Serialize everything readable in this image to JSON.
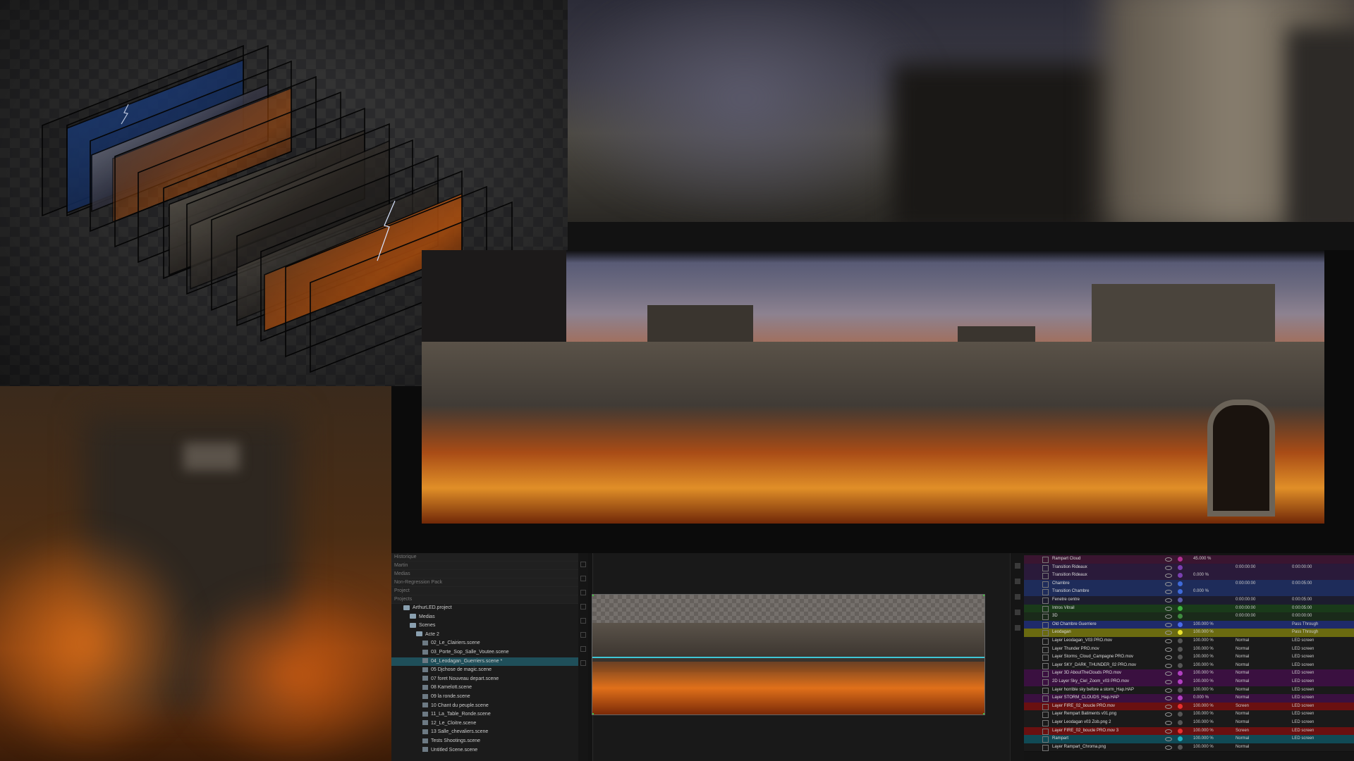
{
  "project_tree": {
    "headers": [
      "Historique",
      "Martin",
      "Medias",
      "Non-Regression Pack",
      "Project",
      "Projects"
    ],
    "items": [
      {
        "label": "ArthurLED.project",
        "kind": "project",
        "indent": 1,
        "selected": false
      },
      {
        "label": "Medias",
        "kind": "folder",
        "indent": 2,
        "selected": false
      },
      {
        "label": "Scenes",
        "kind": "folder",
        "indent": 2,
        "selected": false
      },
      {
        "label": "Acte 2",
        "kind": "folder",
        "indent": 3,
        "selected": false
      },
      {
        "label": "02_Le_Clairiers.scene",
        "kind": "scene",
        "indent": 4,
        "selected": false
      },
      {
        "label": "03_Porte_Sop_Salle_Voutee.scene",
        "kind": "scene",
        "indent": 4,
        "selected": false
      },
      {
        "label": "04_Leodagan_Guerriers.scene *",
        "kind": "scene",
        "indent": 4,
        "selected": true
      },
      {
        "label": "05 Djchose de magic.scene",
        "kind": "scene",
        "indent": 4,
        "selected": false
      },
      {
        "label": "07 foret Nouveau depart.scene",
        "kind": "scene",
        "indent": 4,
        "selected": false
      },
      {
        "label": "08 Kamelott.scene",
        "kind": "scene",
        "indent": 4,
        "selected": false
      },
      {
        "label": "09 la ronde.scene",
        "kind": "scene",
        "indent": 4,
        "selected": false
      },
      {
        "label": "10 Chant du peuple.scene",
        "kind": "scene",
        "indent": 4,
        "selected": false
      },
      {
        "label": "11_La_Table_Ronde.scene",
        "kind": "scene",
        "indent": 4,
        "selected": false
      },
      {
        "label": "12_Le_Cloitre.scene",
        "kind": "scene",
        "indent": 4,
        "selected": false
      },
      {
        "label": "13 Salle_chevaliers.scene",
        "kind": "scene",
        "indent": 4,
        "selected": false
      },
      {
        "label": "Tests Shootings.scene",
        "kind": "scene",
        "indent": 4,
        "selected": false
      },
      {
        "label": "Untitled Scene.scene",
        "kind": "scene",
        "indent": 4,
        "selected": false
      }
    ]
  },
  "layers": {
    "rows": [
      {
        "name": "Rampart Cloud",
        "opacity": "45.000 %",
        "blend": "",
        "target": "",
        "bg": "#3a1530",
        "dot": "#b03090"
      },
      {
        "name": "Transition Rideaux",
        "opacity": "",
        "blend": "0:00:00:00",
        "target": "0:00:00:00",
        "bg": "#2a1a3a",
        "dot": "#7a3fb0"
      },
      {
        "name": "Transition Rideaux",
        "opacity": "0.000 %",
        "blend": "",
        "target": "",
        "bg": "#2a1a3a",
        "dot": "#7a3fb0"
      },
      {
        "name": "Chambre",
        "opacity": "",
        "blend": "0:00:00:00",
        "target": "0:00:05:00",
        "bg": "#1e2c5a",
        "dot": "#3f6ad8"
      },
      {
        "name": "Transition Chambre",
        "opacity": "0.000 %",
        "blend": "",
        "target": "",
        "bg": "#1e2c5a",
        "dot": "#3f6ad8"
      },
      {
        "name": "Fenetre centre",
        "opacity": "",
        "blend": "0:00:00:00",
        "target": "0:00:05:00",
        "bg": "#1c1c2e",
        "dot": "#5a5aa8"
      },
      {
        "name": "Intros Vitrail",
        "opacity": "",
        "blend": "0:00:00:00",
        "target": "0:00:05:00",
        "bg": "#1a3a1a",
        "dot": "#3fb03f"
      },
      {
        "name": "3D",
        "opacity": "",
        "blend": "0:00:00:00",
        "target": "0:00:00:00",
        "bg": "#1a2a1a",
        "dot": "#3f8a3f"
      },
      {
        "name": "Old Chambre Guerriere",
        "opacity": "100.000 %",
        "blend": "",
        "target": "Pass Through",
        "bg": "#1e2a6a",
        "dot": "#4a6ae8"
      },
      {
        "name": "Leodagan",
        "opacity": "100.000 %",
        "blend": "",
        "target": "Pass Through",
        "bg": "#6a6a10",
        "dot": "#e8e030"
      },
      {
        "name": "Layer Leodagan_V03 PRO.mov",
        "opacity": "100.000 %",
        "blend": "Normal",
        "target": "LED screen",
        "bg": "#1a1a1a",
        "dot": "#555"
      },
      {
        "name": "Layer Thunder PRO.mov",
        "opacity": "100.000 %",
        "blend": "Normal",
        "target": "LED screen",
        "bg": "#1a1a1a",
        "dot": "#555"
      },
      {
        "name": "Layer Storms_Cloud_Campagne PRO.mov",
        "opacity": "100.000 %",
        "blend": "Normal",
        "target": "LED screen",
        "bg": "#1a1a1a",
        "dot": "#555"
      },
      {
        "name": "Layer SKY_DARK_THUNDER_02 PRO.mov",
        "opacity": "100.000 %",
        "blend": "Normal",
        "target": "LED screen",
        "bg": "#1a1a1a",
        "dot": "#555"
      },
      {
        "name": "Layer 3D AboutTheClouds PRO.mov",
        "opacity": "100.000 %",
        "blend": "Normal",
        "target": "LED screen",
        "bg": "#3a1040",
        "dot": "#b040c0"
      },
      {
        "name": "2D Layer Sky_Ciel_Zoom_v03 PRO.mov",
        "opacity": "100.000 %",
        "blend": "Normal",
        "target": "LED screen",
        "bg": "#3a1040",
        "dot": "#b040c0"
      },
      {
        "name": "Layer horrible sky before a storm_Hap.HAP",
        "opacity": "100.000 %",
        "blend": "Normal",
        "target": "LED screen",
        "bg": "#1a1a1a",
        "dot": "#555"
      },
      {
        "name": "Layer STORM_CLOUDS_Hap.HAP",
        "opacity": "0.000 %",
        "blend": "Normal",
        "target": "LED screen",
        "bg": "#3a1040",
        "dot": "#b040c0"
      },
      {
        "name": "Layer FIRE_02_boucle PRO.mov",
        "opacity": "100.000 %",
        "blend": "Screen",
        "target": "LED screen",
        "bg": "#6a1010",
        "dot": "#e83030"
      },
      {
        "name": "Layer Rempart Batiments v01.png",
        "opacity": "100.000 %",
        "blend": "Normal",
        "target": "LED screen",
        "bg": "#1a1a1a",
        "dot": "#555"
      },
      {
        "name": "Layer Leodagan v03 Zob.png 2",
        "opacity": "100.000 %",
        "blend": "Normal",
        "target": "LED screen",
        "bg": "#1a1a1a",
        "dot": "#555"
      },
      {
        "name": "Layer FIRE_02_boucle PRO.mov 3",
        "opacity": "100.000 %",
        "blend": "Screen",
        "target": "LED screen",
        "bg": "#6a1010",
        "dot": "#e83030"
      },
      {
        "name": "Rampart",
        "opacity": "100.000 %",
        "blend": "Normal",
        "target": "LED screen",
        "bg": "#104a55",
        "dot": "#20b0c0"
      },
      {
        "name": "Layer Rampart_Chroma.png",
        "opacity": "100.000 %",
        "blend": "Normal",
        "target": "",
        "bg": "#1a1a1a",
        "dot": "#555"
      }
    ]
  }
}
